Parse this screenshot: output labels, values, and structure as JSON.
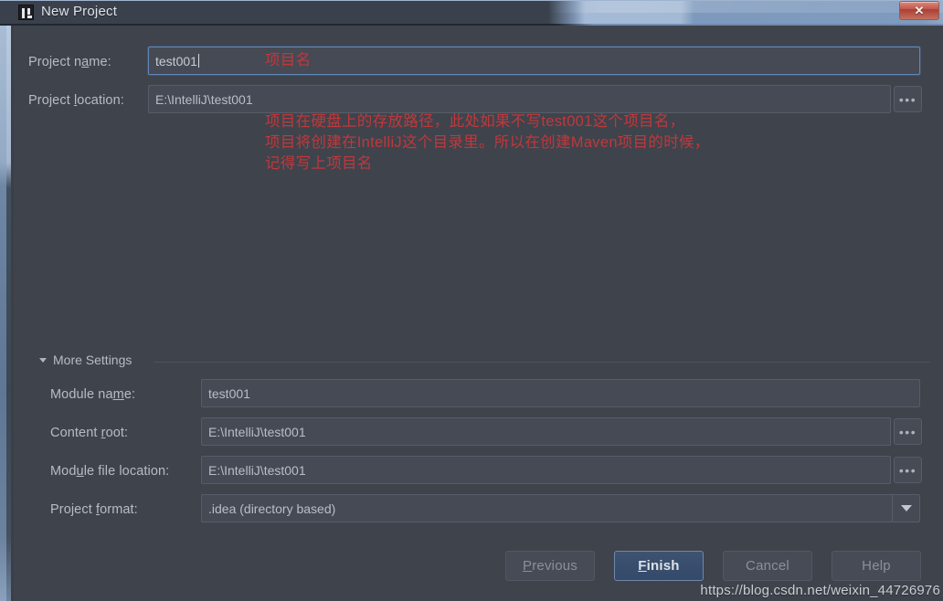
{
  "window": {
    "title": "New Project",
    "icon": "intellij-idea-icon",
    "close_label": "✕"
  },
  "fields": {
    "project_name": {
      "label_before": "Project n",
      "label_mnemonic": "a",
      "label_after": "me:",
      "value": "test001",
      "focused": true
    },
    "project_location": {
      "label_before": "Project ",
      "label_mnemonic": "l",
      "label_after": "ocation:",
      "value": "E:\\IntelliJ\\test001",
      "browse_label": "•••"
    },
    "module_name": {
      "label_before": "Module na",
      "label_mnemonic": "m",
      "label_after": "e:",
      "value": "test001"
    },
    "content_root": {
      "label_before": "Content ",
      "label_mnemonic": "r",
      "label_after": "oot:",
      "value": "E:\\IntelliJ\\test001",
      "browse_label": "•••"
    },
    "module_file_location": {
      "label_before": "Mod",
      "label_mnemonic": "u",
      "label_after": "le file location:",
      "value": "E:\\IntelliJ\\test001",
      "browse_label": "•••"
    },
    "project_format": {
      "label_before": "Project ",
      "label_mnemonic": "f",
      "label_after": "ormat:",
      "value": ".idea (directory based)"
    }
  },
  "group": {
    "more_settings_label": "More Settings",
    "expanded": true
  },
  "annotations": {
    "project_name_note": "项目名",
    "project_location_note_line1": "项目在硬盘上的存放路径，此处如果不写test001这个项目名，",
    "project_location_note_line2": "项目将创建在IntelliJ这个目录里。所以在创建Maven项目的时候，",
    "project_location_note_line3": "记得写上项目名",
    "color": "#c0383b"
  },
  "buttons": {
    "previous": {
      "before": "",
      "mnemonic": "P",
      "after": "revious"
    },
    "finish": {
      "before": "",
      "mnemonic": "F",
      "after": "inish"
    },
    "cancel": {
      "before": "Cancel",
      "mnemonic": "",
      "after": ""
    },
    "help": {
      "before": "Help",
      "mnemonic": "",
      "after": ""
    }
  },
  "watermark": {
    "text": "https://blog.csdn.net/weixin_44726976"
  }
}
